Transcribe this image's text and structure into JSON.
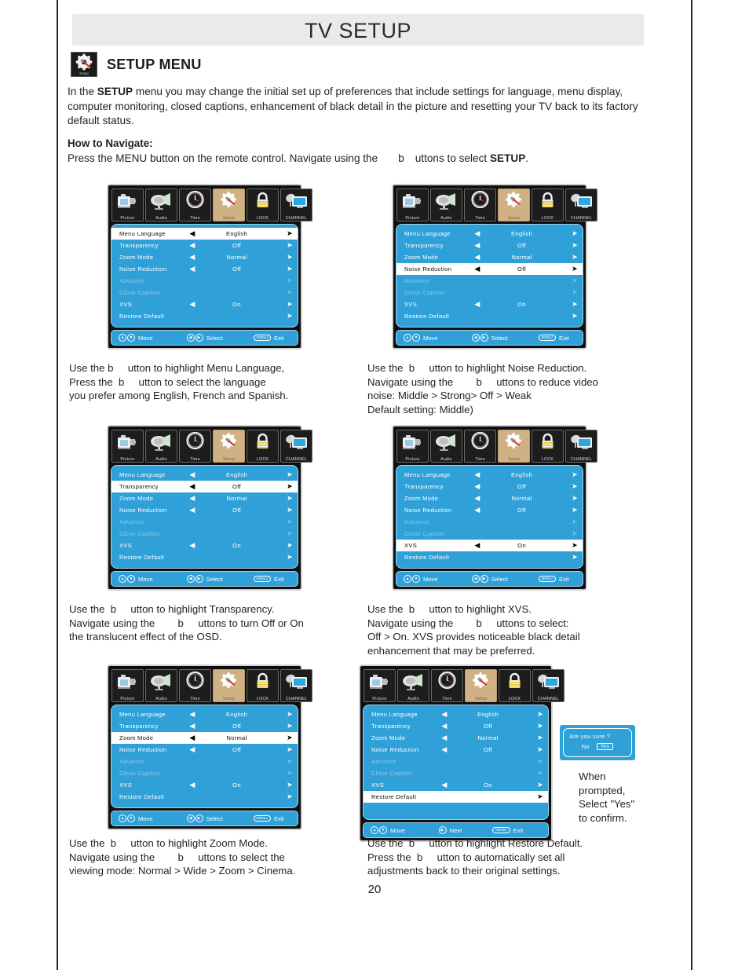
{
  "page": {
    "header_title": "TV SETUP",
    "section_title": "SETUP MENU",
    "section_icon_caption": "Setup",
    "page_number": "20"
  },
  "intro": {
    "lead": "In the ",
    "bold": "SETUP",
    "rest": " menu you may change the initial set up of preferences that include settings for language, menu display, computer monitoring, closed captions, enhancement of black detail in the picture and resetting your TV back to its factory default status."
  },
  "navigate": {
    "heading": "How to Navigate:",
    "text_before": "Press the MENU button on the remote control. Navigate using the",
    "glyph": "b",
    "text_after": "uttons to select ",
    "target": "SETUP",
    "period": "."
  },
  "icon_tabs": [
    {
      "name": "picture-icon",
      "label": "Picture",
      "active": false
    },
    {
      "name": "audio-icon",
      "label": "Audio",
      "active": false
    },
    {
      "name": "time-icon",
      "label": "Time",
      "active": false
    },
    {
      "name": "setup-icon",
      "label": "Setup",
      "active": true
    },
    {
      "name": "lock-icon",
      "label": "LOCK",
      "active": false
    },
    {
      "name": "channel-icon",
      "label": "CHANNEL",
      "active": false
    }
  ],
  "menu_items": [
    {
      "label": "Menu Language",
      "value": "English",
      "left_arrow": true,
      "right_arrow": true,
      "dim": false
    },
    {
      "label": "Transparency",
      "value": "Off",
      "left_arrow": true,
      "right_arrow": true,
      "dim": false
    },
    {
      "label": "Zoom Mode",
      "value": "Normal",
      "left_arrow": true,
      "right_arrow": true,
      "dim": false
    },
    {
      "label": "Noise Reduction",
      "value": "Off",
      "left_arrow": true,
      "right_arrow": true,
      "dim": false
    },
    {
      "label": "Advance",
      "value": "",
      "left_arrow": false,
      "right_arrow": true,
      "dim": true
    },
    {
      "label": "Close Caption",
      "value": "",
      "left_arrow": false,
      "right_arrow": true,
      "dim": true
    },
    {
      "label": "XVS",
      "value": "On",
      "left_arrow": true,
      "right_arrow": true,
      "dim": false
    },
    {
      "label": "Restore Default",
      "value": "",
      "left_arrow": false,
      "right_arrow": true,
      "dim": false
    }
  ],
  "footer": {
    "move": "Move",
    "select": "Select",
    "next": "Next",
    "exit": "Exit",
    "menu_pill": "MENU"
  },
  "panels": [
    {
      "id": "panel-1",
      "selected_index": 0,
      "footer_mid": "Select"
    },
    {
      "id": "panel-2",
      "selected_index": 3,
      "footer_mid": "Select"
    },
    {
      "id": "panel-3",
      "selected_index": 1,
      "footer_mid": "Select"
    },
    {
      "id": "panel-4",
      "selected_index": 6,
      "footer_mid": "Select"
    },
    {
      "id": "panel-5",
      "selected_index": 2,
      "footer_mid": "Select"
    },
    {
      "id": "panel-6",
      "selected_index": 7,
      "footer_mid": "Next"
    }
  ],
  "captions": {
    "c1": [
      "Use the b     utton to highlight Menu Language,",
      "Press the  b     utton to select the language",
      "you prefer among English, French and Spanish."
    ],
    "c2": [
      "Use the  b     utton to highlight Noise Reduction.",
      "Navigate using the        b     uttons to reduce video",
      "noise: Middle > Strong> Off > Weak",
      "Default setting: Middle)"
    ],
    "c3": [
      "Use the  b     utton to highlight Transparency.",
      "Navigate using the        b     uttons to turn Off or On",
      "the translucent effect of the OSD."
    ],
    "c4": [
      "Use the  b     utton to highlight XVS.",
      "Navigate using the        b     uttons to select:",
      "Off > On. XVS provides noticeable black detail",
      "enhancement that may be preferred."
    ],
    "c5": [
      "Use the  b     utton to highlight Zoom Mode.",
      "Navigate using the        b     uttons to select the",
      "viewing mode: Normal > Wide > Zoom > Cinema."
    ],
    "c6": [
      "Use the  b     utton to highlight Restore Default.",
      "Press the  b     utton to automatically set all",
      "adjustments back to their original settings."
    ]
  },
  "confirm_dialog": {
    "question": "Are  you sure ?",
    "no": "No",
    "yes": "Yes"
  },
  "confirm_note": [
    "When",
    "prompted,",
    "Select \"Yes\"",
    "to confirm."
  ],
  "colors": {
    "osd_blue": "#2fa1d8",
    "osd_border": "#9fd4ee",
    "tab_active": "#cfb183",
    "header_band": "#e9ebeb",
    "text": "#231f20"
  }
}
